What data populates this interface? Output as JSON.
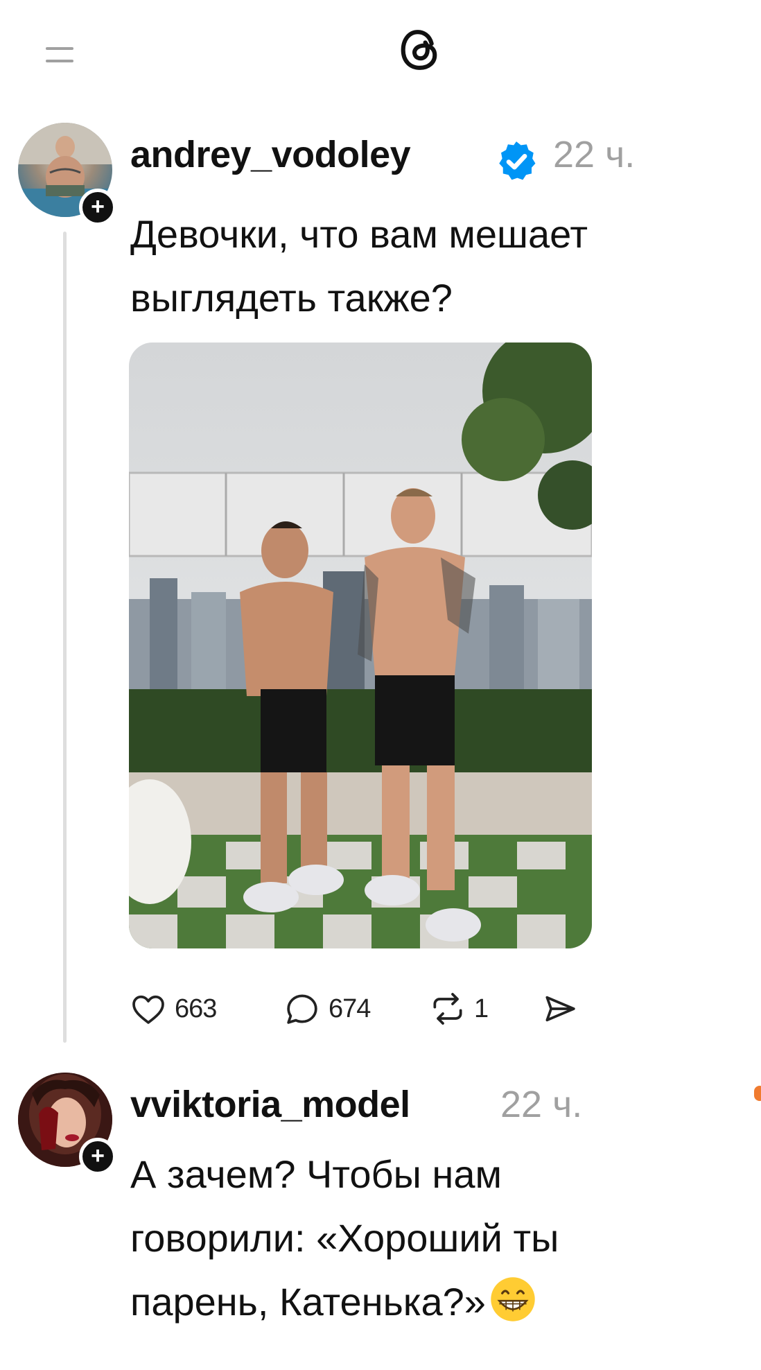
{
  "header": {
    "menu_icon": "hamburger-icon",
    "logo_icon": "threads-logo"
  },
  "posts": [
    {
      "username": "andrey_vodoley",
      "verified": true,
      "time": "22 ч.",
      "text_line1": "Девочки, что вам мешает",
      "text_line2": "выглядеть также?",
      "photo": "two shirtless men posing on rooftop with city skyline",
      "stats": {
        "likes": "663",
        "replies": "674",
        "reposts": "1"
      }
    },
    {
      "username": "vviktoria_model",
      "time": "22 ч.",
      "text_line1": "А зачем? Чтобы нам",
      "text_line2": "говорили: «Хороший ты",
      "text_line3": "парень, Катенька?»",
      "emoji": "grinning-face-emoji"
    }
  ],
  "colors": {
    "accent_verified": "#0095f6",
    "muted": "#a0a0a0",
    "thread_line": "#dedede"
  }
}
